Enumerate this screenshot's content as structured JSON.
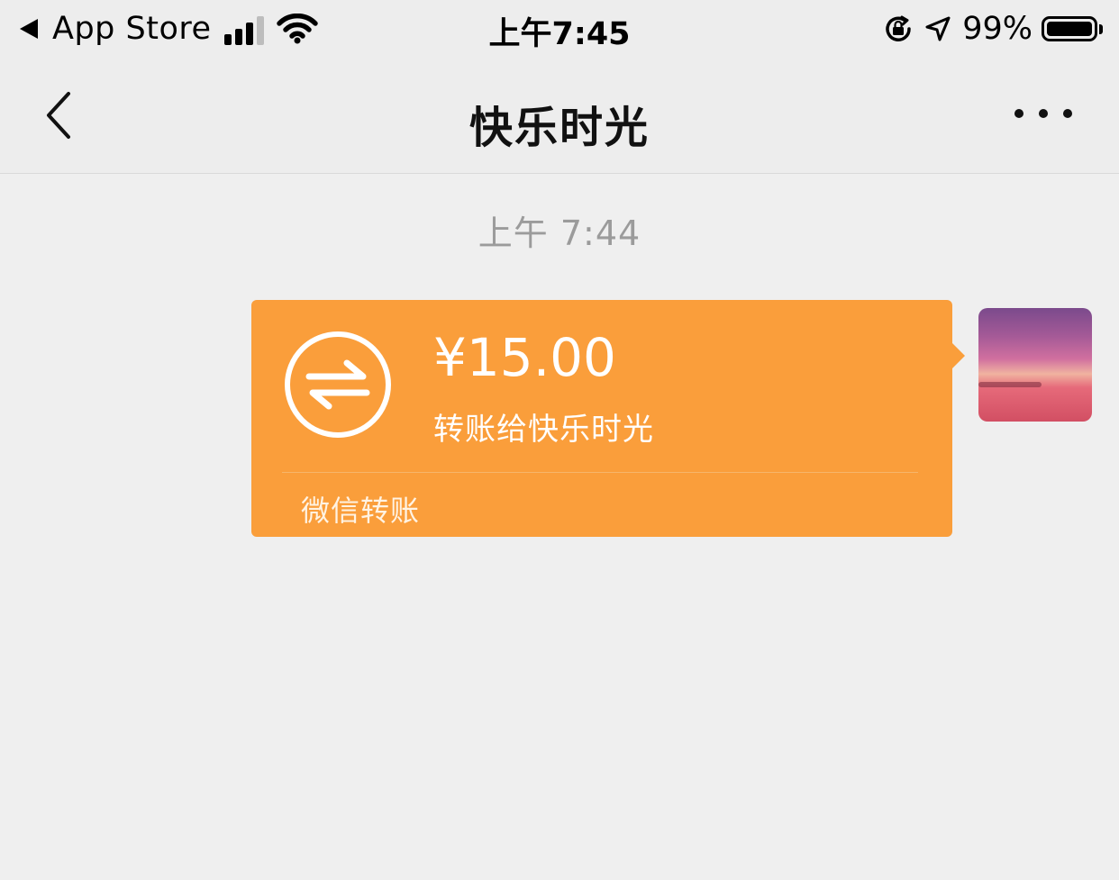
{
  "status_bar": {
    "back_app_label": "App Store",
    "time": "上午7:45",
    "battery_percent": "99%",
    "battery_level": 0.99,
    "signal_bars": 3
  },
  "nav": {
    "title": "快乐时光"
  },
  "chat": {
    "timestamp": "上午 7:44",
    "transfer": {
      "amount": "¥15.00",
      "description": "转账给快乐时光",
      "footer": "微信转账",
      "color": "#fa9e3b"
    }
  }
}
